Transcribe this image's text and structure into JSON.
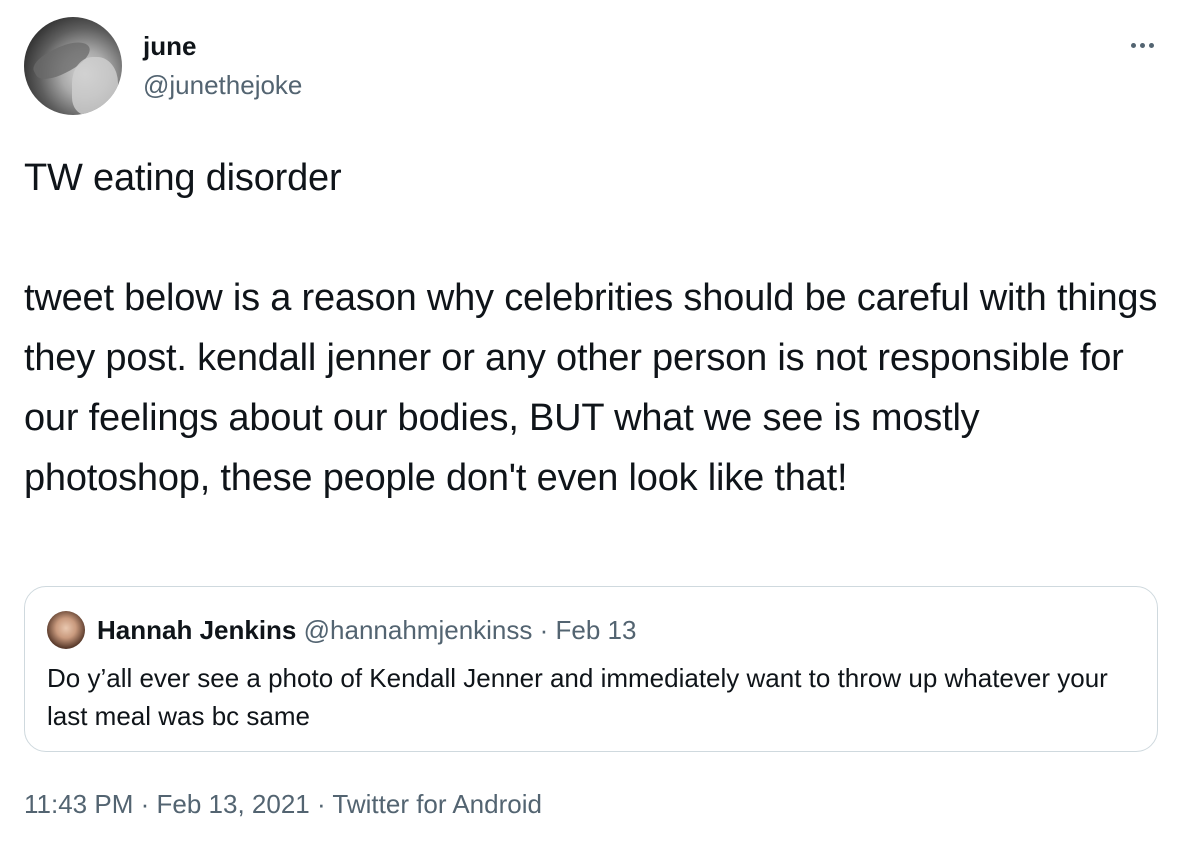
{
  "author": {
    "display_name": "june",
    "handle": "@junethejoke"
  },
  "tweet": {
    "first_line": "TW eating disorder",
    "body": "tweet below is a reason why celebrities should be careful with things they post. kendall jenner or any other person is not responsible for our feelings about our bodies, BUT what we see is mostly photoshop, these people don't even look like that!"
  },
  "quoted_tweet": {
    "display_name": "Hannah Jenkins",
    "handle": "@hannahmjenkinss",
    "separator": "·",
    "date": "Feb 13",
    "text": "Do y’all ever see a photo of Kendall Jenner and immediately want to throw up whatever your last meal was bc same"
  },
  "meta": {
    "time": "11:43 PM",
    "separator": "·",
    "date": "Feb 13, 2021",
    "source": "Twitter for Android"
  },
  "icons": {
    "more": "more-horizontal-icon"
  },
  "colors": {
    "text_primary": "#0f1419",
    "text_secondary": "#536471",
    "border": "#cfd9de"
  }
}
